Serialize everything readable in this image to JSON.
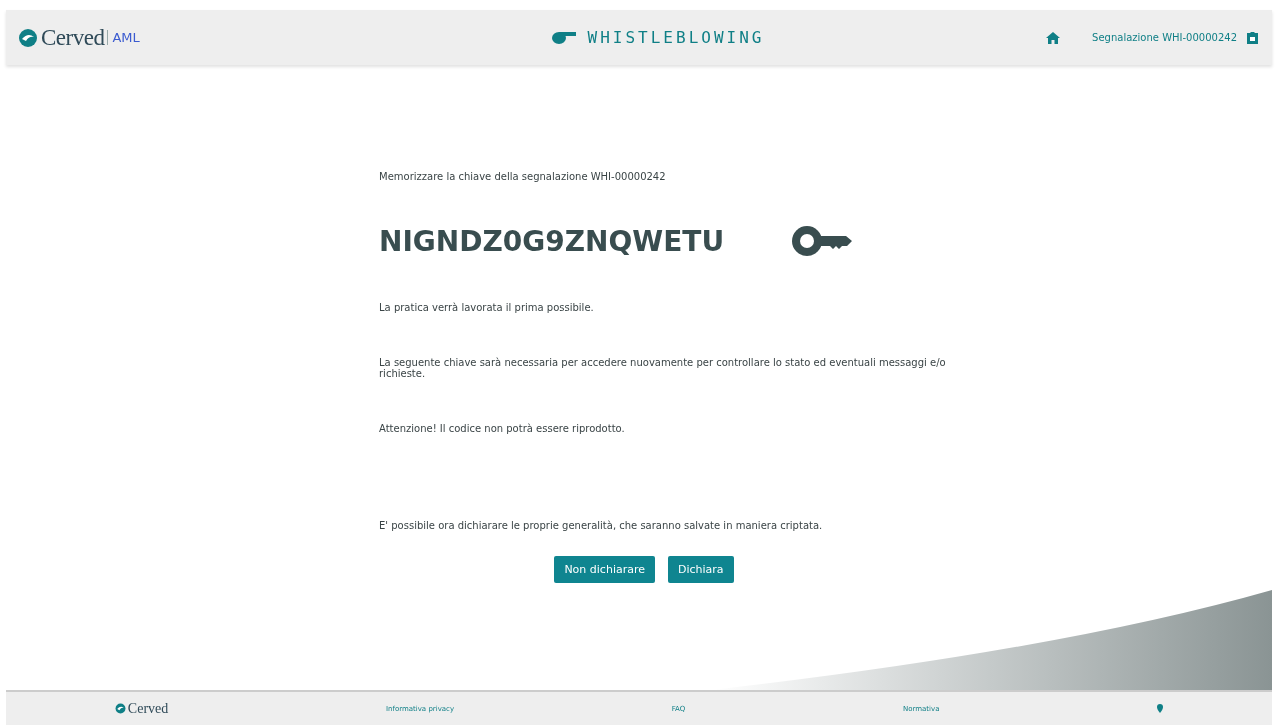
{
  "header": {
    "brand": "Cerved",
    "product": "AML",
    "app_title": "WHISTLEBLOWING",
    "report_label": "Segnalazione WHI-00000242"
  },
  "content": {
    "intro": "Memorizzare la chiave della segnalazione WHI-00000242",
    "key": "NIGNDZ0G9ZNQWETU",
    "paragraphs": [
      "La pratica verrà lavorata il prima possibile.",
      "La seguente chiave sarà necessaria per accedere nuovamente per controllare lo stato ed eventuali messaggi e/o richieste.",
      "Attenzione! Il codice non potrà essere riprodotto."
    ],
    "declare_text": "E' possibile ora dichiarare le proprie generalità, che saranno salvate in maniera criptata.",
    "buttons": [
      "Non dichiarare",
      "Dichiara"
    ]
  },
  "footer": {
    "brand": "Cerved",
    "links": [
      "Informativa privacy",
      "FAQ",
      "Normativa"
    ]
  }
}
